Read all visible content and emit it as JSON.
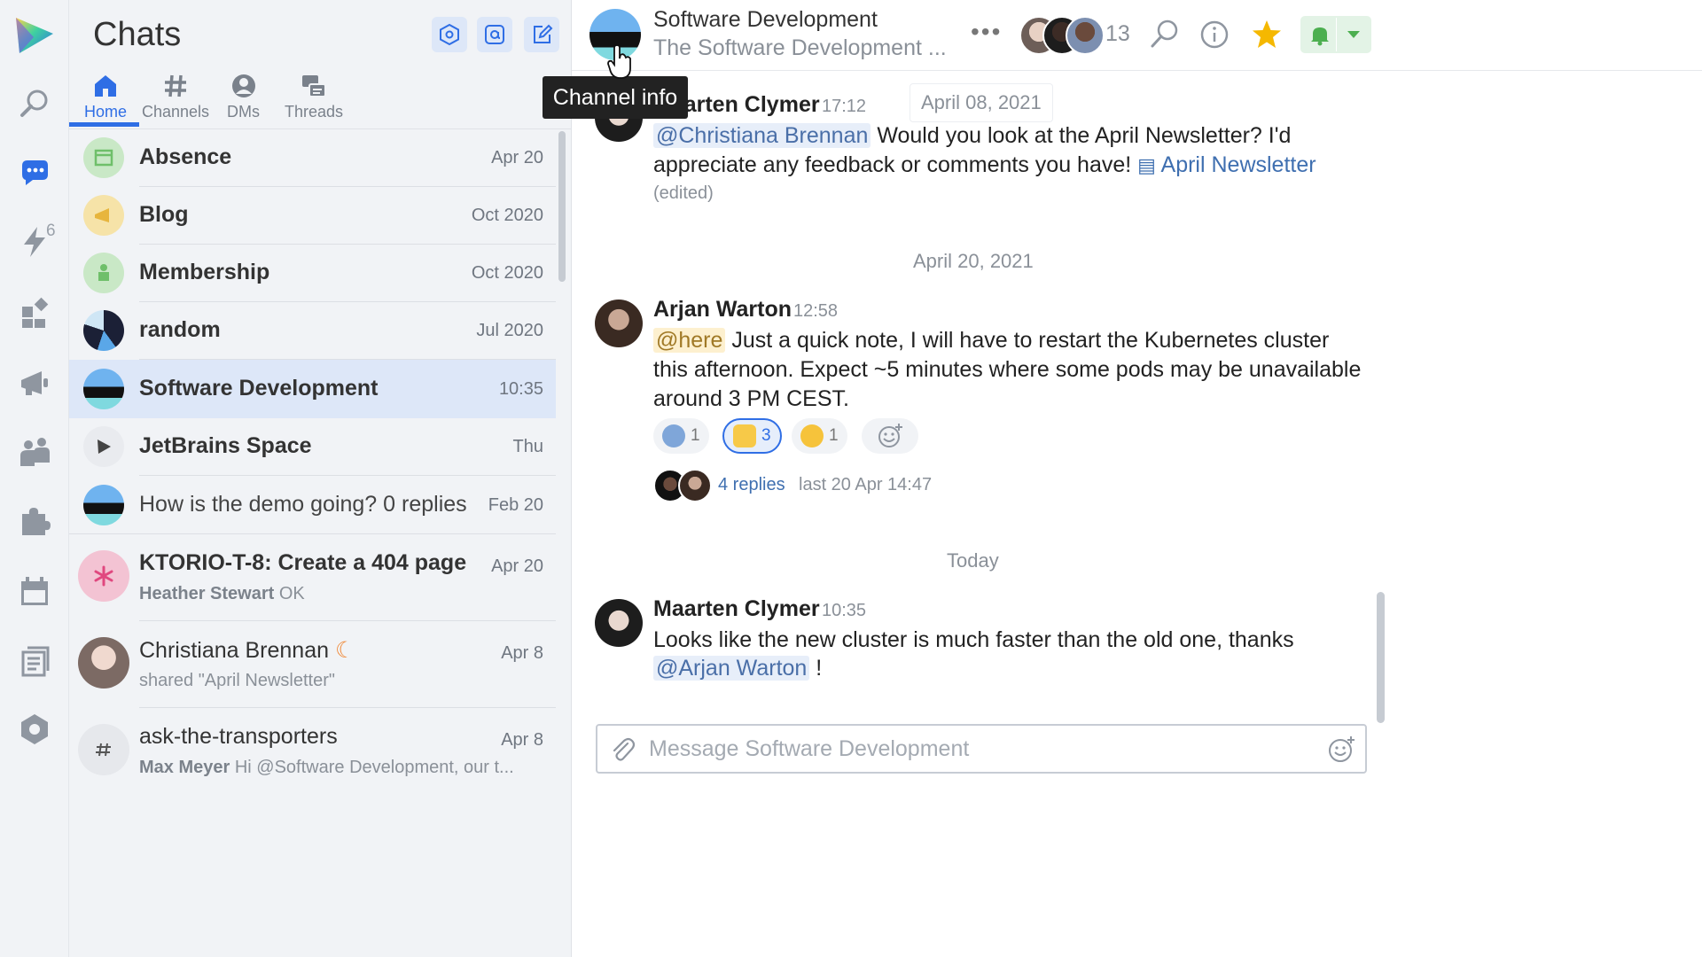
{
  "panel": {
    "title": "Chats",
    "tabs": [
      {
        "label": "Home"
      },
      {
        "label": "Channels"
      },
      {
        "label": "DMs"
      },
      {
        "label": "Threads"
      }
    ]
  },
  "rail": {
    "notifications_badge": "6",
    "items": [
      "search-icon",
      "chats-icon",
      "lightning-icon",
      "apps-icon",
      "megaphone-icon",
      "teams-icon",
      "puzzle-icon",
      "calendar-icon",
      "documents-icon",
      "settings-icon"
    ]
  },
  "chats": [
    {
      "name": "Absence",
      "date": "Apr 20"
    },
    {
      "name": "Blog",
      "date": "Oct 2020"
    },
    {
      "name": "Membership",
      "date": "Oct 2020"
    },
    {
      "name": "random",
      "date": "Jul 2020"
    },
    {
      "name": "Software Development",
      "date": "10:35"
    },
    {
      "name": "JetBrains Space",
      "date": "Thu"
    },
    {
      "name": "How is the demo going? 0 replies",
      "date": "Feb 20"
    },
    {
      "name": "KTORIO-T-8: Create a 404 page",
      "date": "Apr 20",
      "sub_author": "Heather Stewart",
      "sub_text": " OK"
    },
    {
      "name": "Christiana Brennan",
      "date": "Apr 8",
      "sub_text": "shared \"April Newsletter\""
    },
    {
      "name": "ask-the-transporters",
      "date": "Apr 8",
      "sub_author": "Max Meyer",
      "sub_text": " Hi @Software Development, our t..."
    }
  ],
  "header": {
    "title": "Software Development",
    "subtitle": "The Software Development ...",
    "member_count": "13",
    "tooltip": "Channel info"
  },
  "messages": {
    "date1": "April 08, 2021",
    "m1": {
      "author": "Maarten Clymer",
      "time": "17:12",
      "mention": "@Christiana Brennan",
      "line1_rest": " Would you look at the April Newsletter? I'd",
      "line2": "appreciate any feedback or comments you have! ",
      "link": "April Newsletter",
      "edited": "(edited)"
    },
    "date2": "April 20, 2021",
    "m2": {
      "author": "Arjan Warton",
      "time": "12:58",
      "mention": "@here",
      "line1_rest": " Just a quick note, I will have to restart the Kubernetes cluster",
      "line2": "this afternoon. Expect ~5 minutes where some pods may be unavailable",
      "line3": "around 3 PM CEST.",
      "reactions": [
        {
          "emoji": "robot",
          "count": "1"
        },
        {
          "emoji": "thumbs-up",
          "count": "3"
        },
        {
          "emoji": "crazy-face",
          "count": "1"
        }
      ],
      "replies": "4 replies",
      "last_reply": "last 20 Apr 14:47"
    },
    "date3": "Today",
    "m3": {
      "author": "Maarten Clymer",
      "time": "10:35",
      "line1": "Looks like the new cluster is much faster than the old one, thanks",
      "mention": "@Arjan Warton",
      "tail": " !"
    }
  },
  "composer": {
    "placeholder": "Message Software Development"
  },
  "colors": {
    "accent": "#2f6ee5",
    "star": "#f5b800",
    "bell": "#4caf50"
  }
}
